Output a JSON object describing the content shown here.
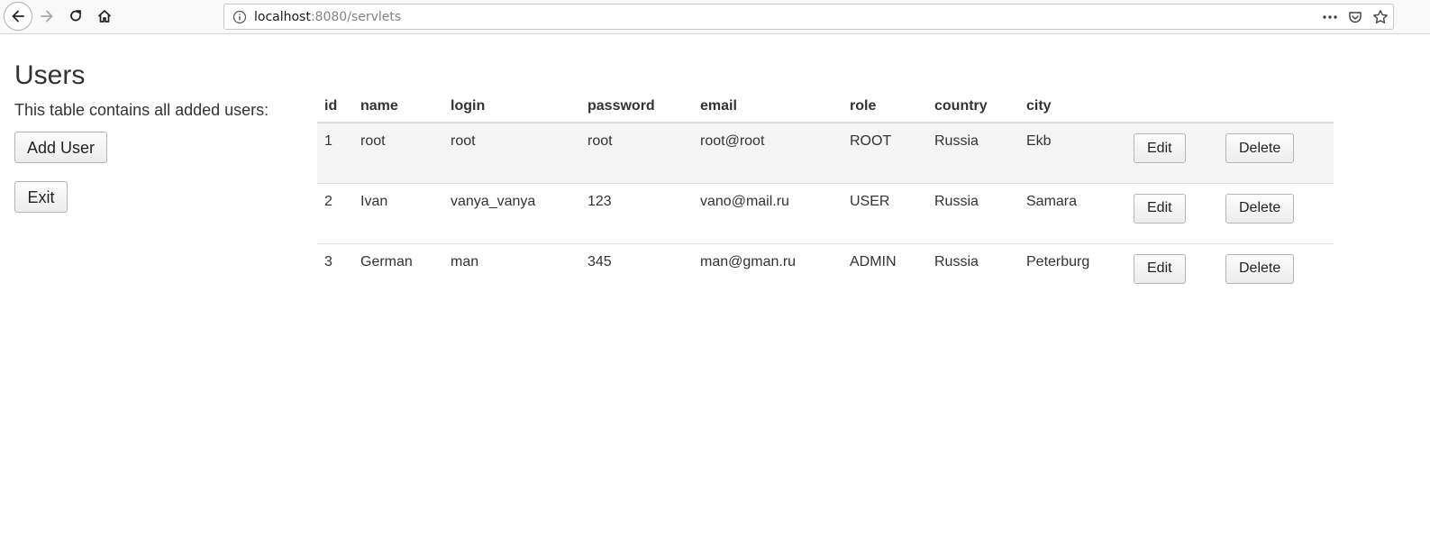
{
  "browser": {
    "url_host": "localhost",
    "url_rest": ":8080/servlets"
  },
  "page": {
    "title": "Users",
    "intro": "This table contains all added users:",
    "add_user_label": "Add User",
    "exit_label": "Exit"
  },
  "table": {
    "headers": {
      "id": "id",
      "name": "name",
      "login": "login",
      "password": "password",
      "email": "email",
      "role": "role",
      "country": "country",
      "city": "city"
    },
    "rows": [
      {
        "id": "1",
        "name": "root",
        "login": "root",
        "password": "root",
        "email": "root@root",
        "role": "ROOT",
        "country": "Russia",
        "city": "Ekb",
        "edit": "Edit",
        "delete": "Delete"
      },
      {
        "id": "2",
        "name": "Ivan",
        "login": "vanya_vanya",
        "password": "123",
        "email": "vano@mail.ru",
        "role": "USER",
        "country": "Russia",
        "city": "Samara",
        "edit": "Edit",
        "delete": "Delete"
      },
      {
        "id": "3",
        "name": "German",
        "login": "man",
        "password": "345",
        "email": "man@gman.ru",
        "role": "ADMIN",
        "country": "Russia",
        "city": "Peterburg",
        "edit": "Edit",
        "delete": "Delete"
      }
    ]
  },
  "icons": {
    "back": "arrow-left-icon",
    "forward": "arrow-right-icon",
    "reload": "reload-icon",
    "home": "home-icon",
    "info": "info-icon",
    "more": "more-dots-icon",
    "pocket": "pocket-icon",
    "bookmark": "star-icon"
  }
}
